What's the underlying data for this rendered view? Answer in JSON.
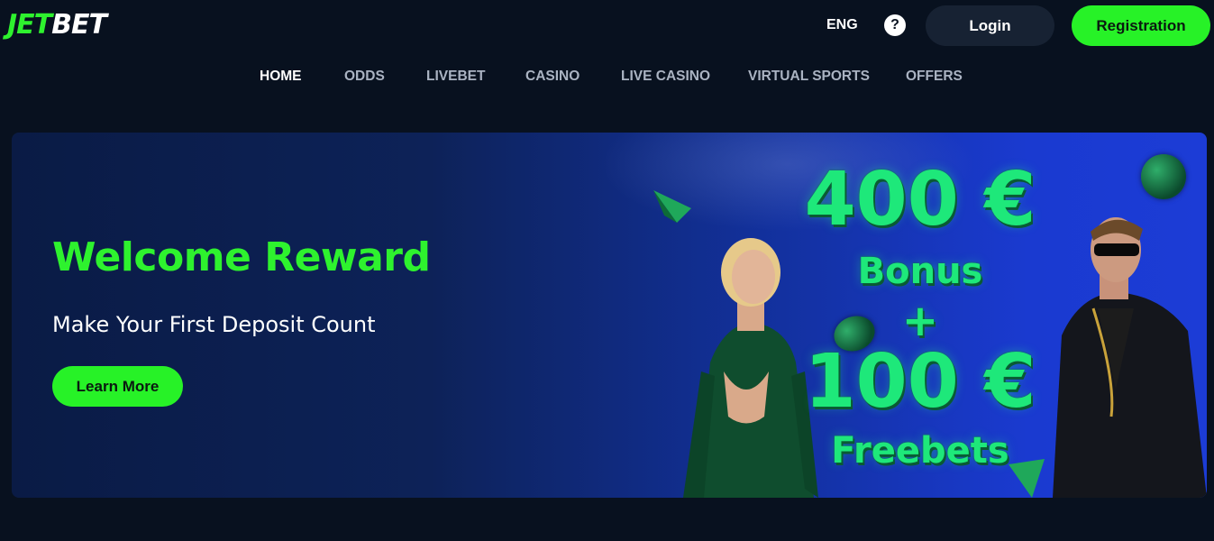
{
  "header": {
    "logo": {
      "part1": "JET",
      "part2": "BET"
    },
    "language": "ENG",
    "help_icon_glyph": "?",
    "login_label": "Login",
    "register_label": "Registration"
  },
  "nav": {
    "items": [
      {
        "label": "HOME",
        "active": true
      },
      {
        "label": "ODDS",
        "active": false
      },
      {
        "label": "LIVEBET",
        "active": false
      },
      {
        "label": "CASINO",
        "active": false
      },
      {
        "label": "LIVE CASINO",
        "active": false
      },
      {
        "label": "VIRTUAL SPORTS",
        "active": false
      },
      {
        "label": "OFFERS",
        "active": false
      }
    ]
  },
  "banner": {
    "title": "Welcome Reward",
    "subtitle": "Make Your First Deposit Count",
    "cta_label": "Learn More",
    "promo": {
      "amount": "400 €",
      "amount_label": "Bonus",
      "plus": "+",
      "free_amount": "100 €",
      "free_label": "Freebets"
    }
  },
  "colors": {
    "background": "#08111f",
    "accent": "#27f227",
    "login_button": "#172233",
    "banner_left": "#0a1b45",
    "banner_right": "#1c3cd6",
    "promo_text": "#1ee87a"
  },
  "icons": {
    "help": "question-circle-icon",
    "chips": "casino-chip-icon",
    "ball": "football-icon"
  }
}
